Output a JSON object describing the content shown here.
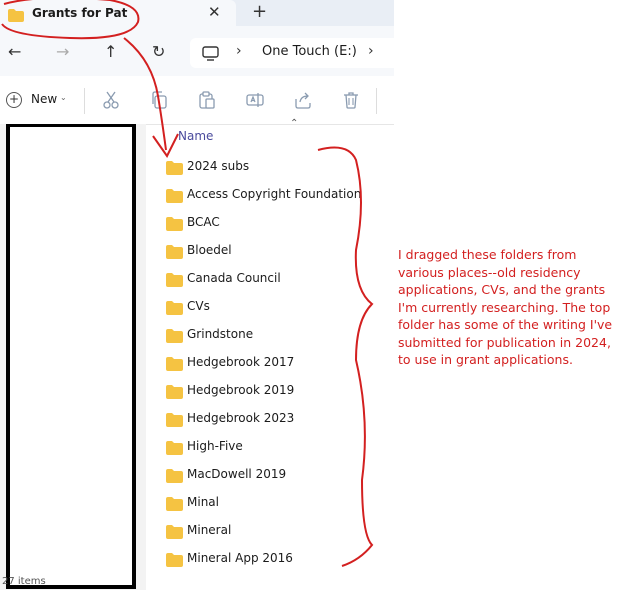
{
  "tab": {
    "title": "Grants for Pat",
    "close_glyph": "✕",
    "new_tab_glyph": "+"
  },
  "address": {
    "path": "One Touch (E:)",
    "chevron": "›"
  },
  "nav": {
    "back": "←",
    "forward": "→",
    "up": "↑",
    "refresh": "↻"
  },
  "toolbar": {
    "new_label": "New",
    "new_caret": "⌄",
    "new_plus": "+"
  },
  "list": {
    "column_header": "Name",
    "sort_glyph": "⌃",
    "items": [
      "2024 subs",
      "Access Copyright Foundation",
      "BCAC",
      "Bloedel",
      "Canada Council",
      "CVs",
      "Grindstone",
      "Hedgebrook 2017",
      "Hedgebrook 2019",
      "Hedgebrook 2023",
      "High-Five",
      "MacDowell 2019",
      "Minal",
      "Mineral",
      "Mineral App 2016"
    ]
  },
  "status": {
    "text": "27 items"
  },
  "annotation": {
    "text": "I dragged these folders from various places--old residency applications, CVs, and the grants I'm currently researching. The top folder has some of the writing I've submitted for publication in 2024, to use in grant applications."
  },
  "colors": {
    "folder": "#f5c342",
    "annotation": "#d32020",
    "accent": "#4a4a9c"
  },
  "icons": [
    "folder-icon",
    "computer-icon",
    "cut-icon",
    "copy-icon",
    "paste-icon",
    "rename-icon",
    "share-icon",
    "delete-icon"
  ]
}
